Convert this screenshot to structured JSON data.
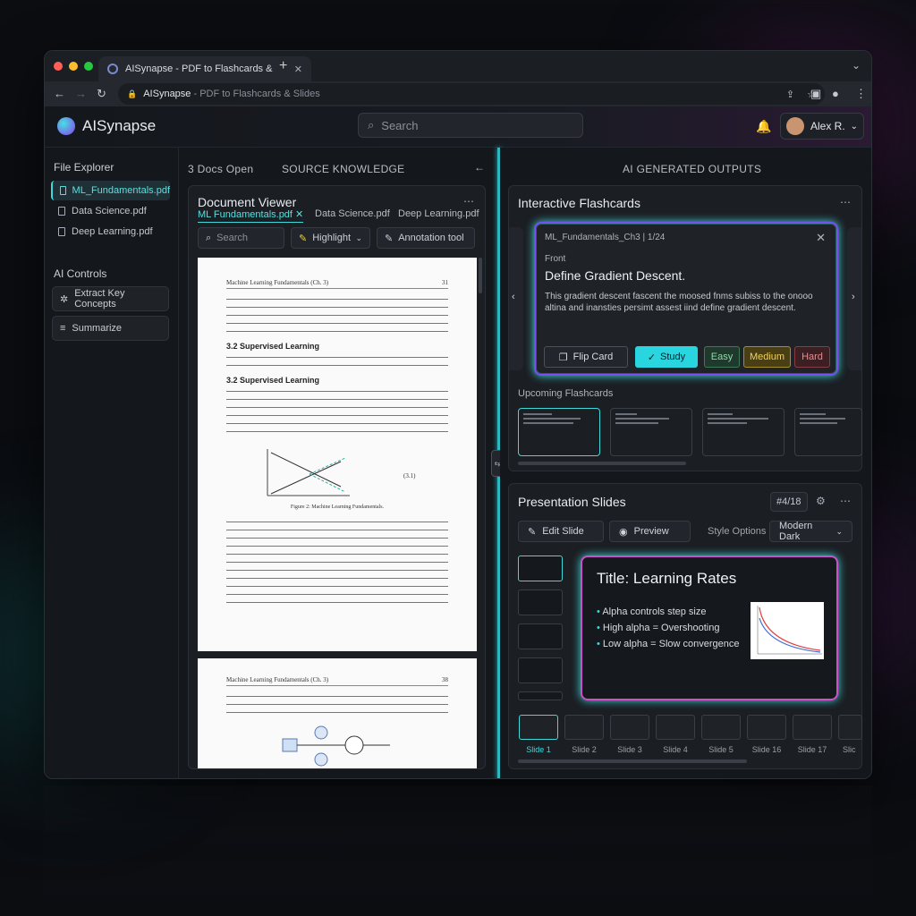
{
  "browser": {
    "tab_title": "AISynapse - PDF to Flashcards &",
    "url_bold": "AISynapse",
    "url_rest": " - PDF to Flashcards & Slides"
  },
  "header": {
    "app_name": "AISynapse",
    "search_placeholder": "Search",
    "user_name": "Alex R."
  },
  "sidebar": {
    "file_explorer_title": "File Explorer",
    "files": [
      "ML_Fundamentals.pdf",
      "Data Science.pdf",
      "Deep Learning.pdf"
    ],
    "ai_controls_title": "AI Controls",
    "controls": [
      "Extract Key Concepts",
      "Summarize"
    ]
  },
  "middle": {
    "docs_open": "3 Docs Open",
    "source_label": "SOURCE KNOWLEDGE",
    "viewer_title": "Document Viewer",
    "tabs": [
      "ML Fundamentals.pdf",
      "Data Science.pdf",
      "Deep Learning.pdf"
    ],
    "search_label": "Search",
    "highlight_label": "Highlight",
    "annotation_label": "Annotation tool",
    "page1": {
      "header_left": "Machine Learning Fundamentals (Ch. 3)",
      "header_right": "31",
      "section1": "3.2    Supervised Learning",
      "section2": "3.2    Supervised Learning",
      "equation_no": "(3.1)",
      "figure_caption": "Figure 2: Machine Learning Fundamentals."
    },
    "page2": {
      "header_left": "Machine Learning Fundamentals (Ch. 3)",
      "header_right": "38"
    }
  },
  "right": {
    "outputs_label": "AI GENERATED OUTPUTS",
    "flashcards": {
      "title": "Interactive Flashcards",
      "card_id": "ML_Fundamentals_Ch3 | 1/24",
      "side_label": "Front",
      "question": "Define Gradient Descent.",
      "answer": "This gradient descent fascent the moosed fnms subiss to the onooo altina and inansties persimt assest iind define gradient descent.",
      "buttons": {
        "flip": "Flip Card",
        "study": "Study",
        "easy": "Easy",
        "medium": "Medium",
        "hard": "Hard"
      },
      "upcoming_title": "Upcoming Flashcards"
    },
    "slides": {
      "title": "Presentation Slides",
      "counter": "#4/18",
      "edit_label": "Edit Slide",
      "preview_label": "Preview",
      "style_options_label": "Style Options",
      "style_value": "Modern Dark",
      "slide_title": "Title: Learning Rates",
      "bullets": [
        "Alpha controls step size",
        "High alpha = Overshooting",
        "Low alpha = Slow convergence"
      ],
      "thumb_labels": [
        "Slide 1",
        "Slide 2",
        "Slide 3",
        "Slide 4",
        "Slide 5",
        "Slide 16",
        "Slide 17",
        "Slic"
      ]
    }
  },
  "colors": {
    "accent_cyan": "#40d8d8",
    "accent_magenta": "#d04ec8",
    "accent_purple": "#7c4df0"
  }
}
